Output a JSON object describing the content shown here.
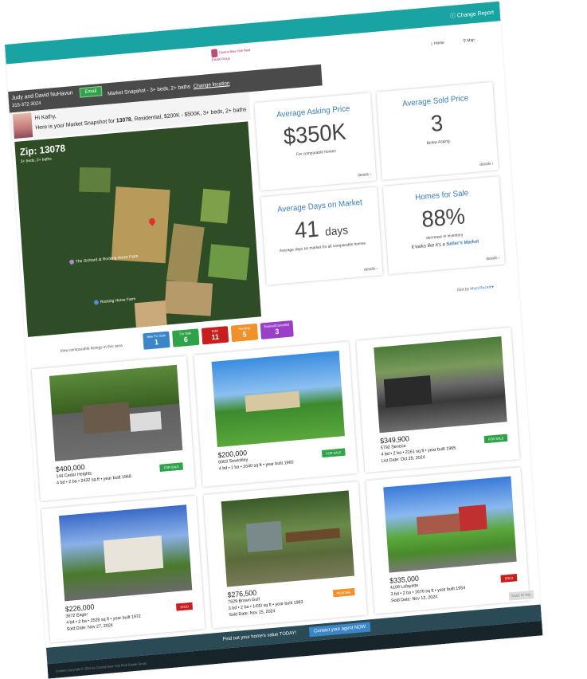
{
  "header": {
    "change_report": "Change Report",
    "logo_text": "Central New York Real Estate Group",
    "nav_home": "Home",
    "nav_map": "Map"
  },
  "agent": {
    "names": "Judy and David NuHavun",
    "phone": "315-372-3024",
    "email_label": "Email",
    "criteria_text": "Market Snapshot - 3+ beds, 2+ baths",
    "change_location": "Change location"
  },
  "greeting": {
    "line1": "Hi Kathy,",
    "line2_prefix": "Here is your Market Snapshot for",
    "zip": "13078",
    "line2_suffix": ", Residential, $200K - $500K, 3+ beds, 2+ baths"
  },
  "map": {
    "zip_label": "Zip: 13078",
    "criteria": "3+ beds, 2+ baths",
    "poi1": "The Orchard at Rocking Horse Farm",
    "poi2": "Rocking Horse Farm"
  },
  "stats": [
    {
      "title": "Average Asking Price",
      "value": "$350K",
      "unit": "",
      "sub": "For comparable homes",
      "extra": "",
      "details": "details"
    },
    {
      "title": "Average Sold Price",
      "value": "3",
      "unit": "",
      "sub": "Below Asking",
      "extra": "",
      "details": "details"
    },
    {
      "title": "Average Days on Market",
      "value": "41",
      "unit": "days",
      "sub": "Average days on market for all comparable homes",
      "extra": "",
      "details": "details"
    },
    {
      "title": "Homes for Sale",
      "value": "88%",
      "unit": "",
      "sub": "decrease in inventory",
      "extra_prefix": "It looks like it's a",
      "extra": "Seller's Market",
      "details": "details"
    }
  ],
  "sort": {
    "prefix": "Sort by",
    "value": "Most Recent"
  },
  "filters": {
    "label": "View comparable listings in this area",
    "pills": [
      {
        "label": "New For Sale",
        "count": "1",
        "color": "#3a86c8"
      },
      {
        "label": "For Sale",
        "count": "6",
        "color": "#2fa24a"
      },
      {
        "label": "Sold",
        "count": "11",
        "color": "#c81e1e"
      },
      {
        "label": "Pending",
        "count": "5",
        "color": "#f0912a"
      },
      {
        "label": "Expired/Cancelled",
        "count": "3",
        "color": "#9b3fc9"
      }
    ]
  },
  "listings": [
    {
      "price": "$400,000",
      "address": "144 Cedar Heights",
      "facts": "4 bd • 2 ba • 2432 sq ft • year built 1968",
      "date": "",
      "badge": "FOR SALE",
      "badge_color": "#2fa24a",
      "photo": "house-stone"
    },
    {
      "price": "$200,000",
      "address": "6003 Sewickley",
      "facts": "4 bd • 1 ba • 1640 sq ft • year built 1960",
      "date": "",
      "badge": "FOR SALE",
      "badge_color": "#2fa24a",
      "photo": "house-lawn"
    },
    {
      "price": "$349,900",
      "address": "5792 Seneca",
      "facts": "4 bd • 2 ba • 2161 sq ft • year built 1965",
      "date": "List Date: Oct 25, 2024",
      "badge": "FOR SALE",
      "badge_color": "#2fa24a",
      "photo": "house-garage"
    },
    {
      "price": "$226,000",
      "address": "3672 Eager",
      "facts": "4 bd • 2 ba • 2528 sq ft • year built 1972",
      "date": "Sold Date: Nov 27, 2024",
      "badge": "SOLD",
      "badge_color": "#c81e1e",
      "photo": "house-white"
    },
    {
      "price": "$276,500",
      "address": "7629 Brown Gulf",
      "facts": "3 bd • 2 ba • 1430 sq ft • year built 1983",
      "date": "Sold Date: Nov 15, 2024",
      "badge": "PENDING",
      "badge_color": "#f0912a",
      "photo": "house-woods"
    },
    {
      "price": "$335,000",
      "address": "4108 Lafayette",
      "facts": "3 bd • 2 ba • 1676 sq ft • year built 1954",
      "date": "Sold Date: Nov 12, 2024",
      "badge": "SOLD",
      "badge_color": "#c81e1e",
      "photo": "house-red"
    }
  ],
  "footer": {
    "text": "Find out your home's value TODAY!",
    "button": "Contact your agent NOW",
    "copyright": "Content Copyright © 2024 by Central New York Real Estate Group",
    "back_to_top": "back to top"
  }
}
